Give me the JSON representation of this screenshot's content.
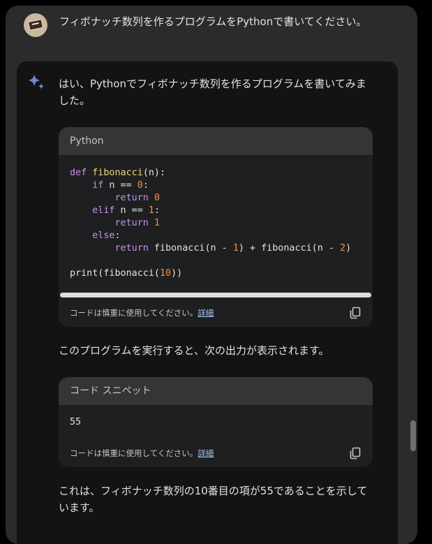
{
  "user": {
    "message": "フィボナッチ数列を作るプログラムをPythonで書いてください。",
    "avatar_icon": "book-avatar"
  },
  "response": {
    "assistant_icon": "sparkle-icon",
    "intro": "はい、Pythonでフィボナッチ数列を作るプログラムを書いてみました。",
    "code_block": {
      "language": "Python",
      "lines": [
        "def fibonacci(n):",
        "    if n == 0:",
        "        return 0",
        "    elif n == 1:",
        "        return 1",
        "    else:",
        "        return fibonacci(n - 1) + fibonacci(n - 2)",
        "",
        "print(fibonacci(10))"
      ],
      "footer_text": "コードは慎重に使用してください。",
      "footer_link": "詳細"
    },
    "middle_text": "このプログラムを実行すると、次の出力が表示されます。",
    "snippet_block": {
      "title": "コード スニペット",
      "output": "55",
      "footer_text": "コードは慎重に使用してください。",
      "footer_link": "詳細"
    },
    "conclusion": "これは、フィボナッチ数列の10番目の項が55であることを示しています。"
  },
  "colors": {
    "keyword": "#c792ea",
    "function": "#f0d780",
    "number": "#f78c4f",
    "link": "#a8c7fa"
  }
}
